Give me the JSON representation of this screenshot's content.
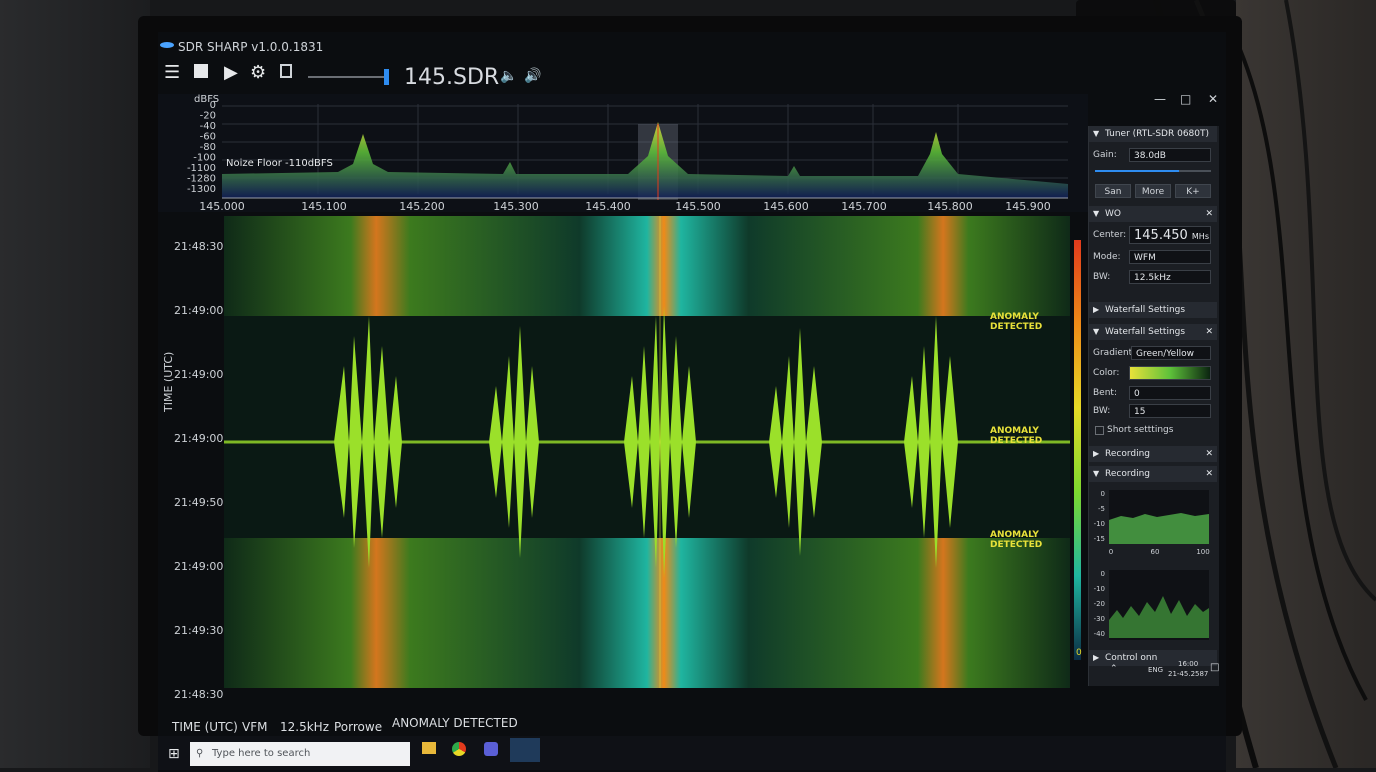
{
  "app": {
    "title": "SDR SHARP v1.0.0.1831"
  },
  "toolbar": {
    "menu_icon": "hamburger-menu-icon",
    "frequency_display": "145.SDR"
  },
  "spectrum": {
    "ylabel": "dBFS",
    "ytick_labels": [
      "0",
      "-20",
      "-40",
      "-60",
      "-80",
      "-100",
      "-1100",
      "-1280",
      "-1300"
    ],
    "noise_floor_label": "Noize Floor -110dBFS",
    "xtick_labels": [
      "145.000",
      "145.100",
      "145.200",
      "145.300",
      "145.400",
      "145.500",
      "145.600",
      "145.700",
      "145.800",
      "145.900"
    ]
  },
  "waterfall": {
    "axis_label": "TIME (UTC)",
    "time_labels": [
      "21:48:30",
      "21:49:00",
      "21:49:00",
      "21:49:00",
      "21:49:50",
      "21:49:00",
      "21:49:30",
      "21:48:30"
    ],
    "anomaly_label_1": "ANOMALY DETECTED",
    "anomaly_label_2": "ANOMALY DETECTED",
    "anomaly_label_3": "ANOMALY DETECTED",
    "colorbar_zero": "0"
  },
  "panel": {
    "tuner": {
      "header": "Tuner (RTL-SDR 0680T)",
      "gain_label": "Gain:",
      "gain_value": "38.0dB",
      "btn_san": "San",
      "btn_more": "More",
      "btn_k": "K+",
      "gain_level_percent": 72
    },
    "wo": {
      "header": "WO",
      "center_label": "Center:",
      "center_value": "145.450",
      "center_unit": "MHs",
      "mode_label": "Mode:",
      "mode_value": "WFM",
      "bw_label": "BW:",
      "bw_value": "12.5kHz"
    },
    "waterfall_collapsed": {
      "header": "Waterfall Settings"
    },
    "waterfall": {
      "header": "Waterfall Settings",
      "gradient_label": "Gradient:",
      "gradient_value": "Green/Yellow",
      "color_label": "Color:",
      "bent_label": "Bent:",
      "bent_value": "0",
      "bw_label": "BW:",
      "bw_value": "15",
      "short_settings": "Short setttings"
    },
    "recording1": {
      "header": "Recording"
    },
    "recording2": {
      "header": "Recording",
      "mini1_yticks": [
        "0",
        "-5",
        "-10",
        "-15"
      ],
      "mini1_xticks": [
        "0",
        "60",
        "100"
      ],
      "mini2_yticks": [
        "0",
        "-10",
        "-20",
        "-30",
        "-40"
      ]
    },
    "control": {
      "header": "Control onn"
    }
  },
  "statusbar": {
    "time_label": "TIME (UTC)",
    "mode": "VFM",
    "bw": "12.5kHz",
    "power": "Porrowe",
    "anomaly": "ANOMALY DETECTED"
  },
  "taskbar": {
    "search_placeholder": "Type here to search",
    "tray_lang": "ENG",
    "tray_time": "16:00",
    "tray_date": "21-45.2587"
  },
  "colors": {
    "accent": "#2e8cf0",
    "anomaly": "#e8e13a",
    "signal": "#9be02a"
  }
}
